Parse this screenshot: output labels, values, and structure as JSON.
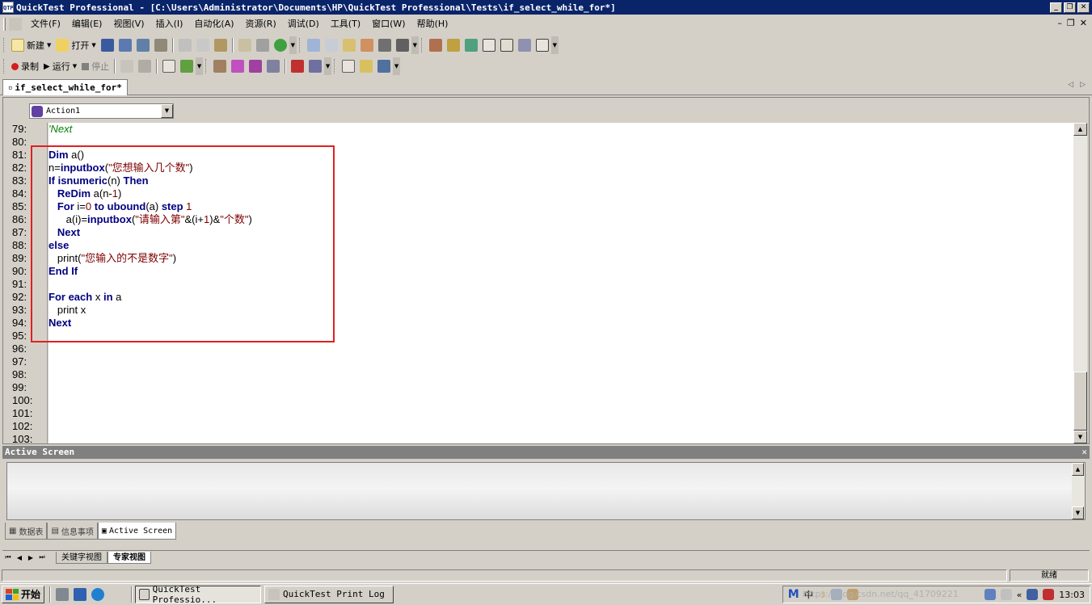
{
  "window": {
    "title": "QuickTest Professional - [C:\\Users\\Administrator\\Documents\\HP\\QuickTest Professional\\Tests\\if_select_while_for*]",
    "app_icon": "QTP"
  },
  "menu": [
    "文件(F)",
    "编辑(E)",
    "视图(V)",
    "插入(I)",
    "自动化(A)",
    "资源(R)",
    "调试(D)",
    "工具(T)",
    "窗口(W)",
    "帮助(H)"
  ],
  "toolbar1": {
    "new_label": "新建",
    "open_label": "打开"
  },
  "toolbar2": {
    "record_label": "录制",
    "run_label": "运行",
    "stop_label": "停止"
  },
  "document_tab": "if_select_while_for*",
  "action_selector": {
    "value": "Action1"
  },
  "editor": {
    "lines": [
      {
        "n": "79:",
        "code": "'Next"
      },
      {
        "n": "80:",
        "code": ""
      },
      {
        "n": "81:",
        "code": "Dim a()"
      },
      {
        "n": "82:",
        "code": "n=inputbox(\"您想输入几个数\")"
      },
      {
        "n": "83:",
        "code": "If isnumeric(n) Then"
      },
      {
        "n": "84:",
        "code": "   ReDim a(n-1)"
      },
      {
        "n": "85:",
        "code": "   For i=0 to ubound(a) step 1"
      },
      {
        "n": "86:",
        "code": "      a(i)=inputbox(\"请输入第\"&(i+1)&\"个数\")"
      },
      {
        "n": "87:",
        "code": "   Next"
      },
      {
        "n": "88:",
        "code": "else"
      },
      {
        "n": "89:",
        "code": "   print(\"您输入的不是数字\")"
      },
      {
        "n": "90:",
        "code": "End If"
      },
      {
        "n": "91:",
        "code": ""
      },
      {
        "n": "92:",
        "code": "For each x in a"
      },
      {
        "n": "93:",
        "code": "   print x"
      },
      {
        "n": "94:",
        "code": "Next"
      },
      {
        "n": "95:",
        "code": ""
      },
      {
        "n": "96:",
        "code": ""
      },
      {
        "n": "97:",
        "code": ""
      },
      {
        "n": "98:",
        "code": ""
      },
      {
        "n": "99:",
        "code": ""
      },
      {
        "n": "100:",
        "code": ""
      },
      {
        "n": "101:",
        "code": ""
      },
      {
        "n": "102:",
        "code": ""
      },
      {
        "n": "103:",
        "code": ""
      }
    ],
    "highlight_color": "#e02020"
  },
  "active_screen": {
    "title": "Active Screen",
    "tabs": [
      "数据表",
      "信息事项",
      "Active Screen"
    ]
  },
  "view_tabs": [
    "关键字视图",
    "专家视图"
  ],
  "status": {
    "ready": "就绪"
  },
  "taskbar": {
    "start": "开始",
    "buttons": [
      "QuickTest Professio...",
      "QuickTest Print Log"
    ],
    "watermark": "https://blog.csdn.net/qq_41709221",
    "clock": "13:03"
  }
}
